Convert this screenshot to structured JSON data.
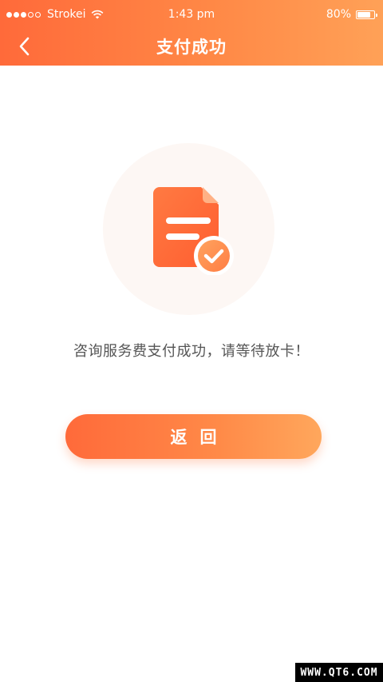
{
  "status_bar": {
    "carrier": "Strokei",
    "time": "1:43 pm",
    "battery": "80%",
    "battery_level": 0.8
  },
  "nav": {
    "title": "支付成功",
    "back_icon": "chevron-left-icon"
  },
  "illustration": {
    "icon": "document-check-icon"
  },
  "message": "咨询服务费支付成功，请等待放卡！",
  "return_button": "返回",
  "watermark": "WWW.QT6.COM",
  "colors": {
    "accent_start": "#ff6a3a",
    "accent_end": "#ffa157",
    "text_gray": "#555555",
    "illus_bg": "#fdf7f4"
  }
}
